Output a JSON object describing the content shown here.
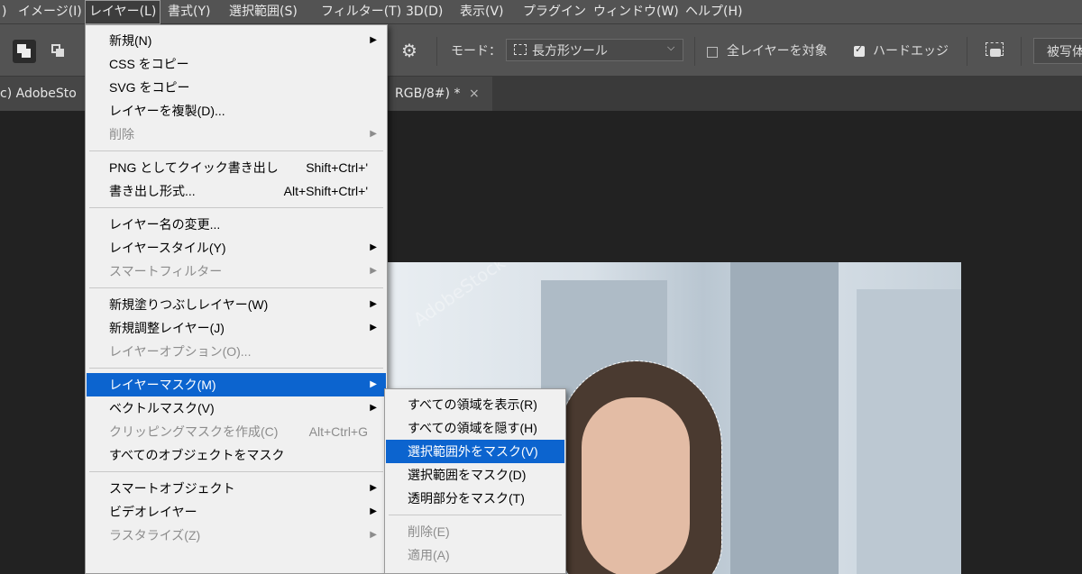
{
  "menubar": {
    "items": [
      {
        "label": ")"
      },
      {
        "label": "イメージ(I)"
      },
      {
        "label": "レイヤー(L)",
        "active": true
      },
      {
        "label": "書式(Y)"
      },
      {
        "label": "選択範囲(S)"
      },
      {
        "label": "フィルター(T)"
      },
      {
        "label": "3D(D)"
      },
      {
        "label": "表示(V)"
      },
      {
        "label": "プラグイン"
      },
      {
        "label": "ウィンドウ(W)"
      },
      {
        "label": "ヘルプ(H)"
      }
    ]
  },
  "options": {
    "mode_label": "モード：",
    "mode_value": "長方形ツール",
    "all_layers_label": "全レイヤーを対象",
    "all_layers_checked": false,
    "hard_edge_label": "ハードエッジ",
    "hard_edge_checked": true,
    "subject_button": "被写体"
  },
  "tabs": [
    {
      "label": "c) AdobeSto"
    },
    {
      "label": "RGB/8#) *",
      "close": "×"
    }
  ],
  "layer_menu": {
    "items": [
      {
        "label": "新規(N)",
        "submenu": true
      },
      {
        "label": "CSS をコピー"
      },
      {
        "label": "SVG をコピー"
      },
      {
        "label": "レイヤーを複製(D)..."
      },
      {
        "label": "削除",
        "disabled": true,
        "submenu": true
      },
      {
        "sep": true
      },
      {
        "label": "PNG としてクイック書き出し",
        "shortcut": "Shift+Ctrl+'"
      },
      {
        "label": "書き出し形式...",
        "shortcut": "Alt+Shift+Ctrl+'"
      },
      {
        "sep": true
      },
      {
        "label": "レイヤー名の変更..."
      },
      {
        "label": "レイヤースタイル(Y)",
        "submenu": true
      },
      {
        "label": "スマートフィルター",
        "disabled": true,
        "submenu": true
      },
      {
        "sep": true
      },
      {
        "label": "新規塗りつぶしレイヤー(W)",
        "submenu": true
      },
      {
        "label": "新規調整レイヤー(J)",
        "submenu": true
      },
      {
        "label": "レイヤーオプション(O)...",
        "disabled": true
      },
      {
        "sep": true
      },
      {
        "label": "レイヤーマスク(M)",
        "submenu": true,
        "highlighted": true
      },
      {
        "label": "ベクトルマスク(V)",
        "submenu": true
      },
      {
        "label": "クリッピングマスクを作成(C)",
        "shortcut": "Alt+Ctrl+G",
        "disabled": true
      },
      {
        "label": "すべてのオブジェクトをマスク"
      },
      {
        "sep": true
      },
      {
        "label": "スマートオブジェクト",
        "submenu": true
      },
      {
        "label": "ビデオレイヤー",
        "submenu": true
      },
      {
        "label": "ラスタライズ(Z)",
        "disabled": true,
        "submenu": true
      }
    ]
  },
  "mask_submenu": {
    "items": [
      {
        "label": "すべての領域を表示(R)"
      },
      {
        "label": "すべての領域を隠す(H)"
      },
      {
        "label": "選択範囲外をマスク(V)",
        "highlighted": true
      },
      {
        "label": "選択範囲をマスク(D)"
      },
      {
        "label": "透明部分をマスク(T)"
      },
      {
        "sep": true
      },
      {
        "label": "削除(E)",
        "disabled": true
      },
      {
        "label": "適用(A)",
        "disabled": true
      }
    ]
  },
  "watermark": "AdobeStock",
  "colors": {
    "highlight": "#0c64cf",
    "menubar": "#535353",
    "menu_bg": "#f0f0f0"
  }
}
